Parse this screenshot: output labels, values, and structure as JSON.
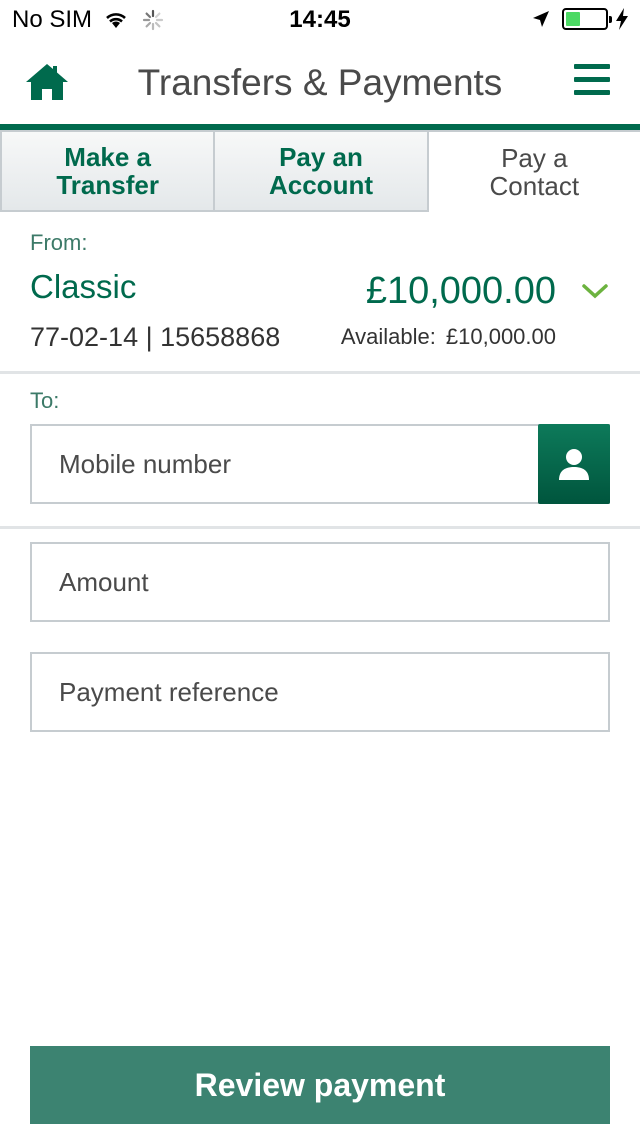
{
  "status_bar": {
    "carrier": "No SIM",
    "time": "14:45"
  },
  "header": {
    "title": "Transfers & Payments"
  },
  "tabs": [
    {
      "label": "Make a\nTransfer",
      "active": false
    },
    {
      "label": "Pay an\nAccount",
      "active": false
    },
    {
      "label": "Pay a\nContact",
      "active": true
    }
  ],
  "from": {
    "label": "From:",
    "account_name": "Classic",
    "balance": "£10,000.00",
    "sort_and_account": "77-02-14 | 15658868",
    "available_label": "Available:",
    "available_amount": "£10,000.00"
  },
  "to": {
    "label": "To:",
    "mobile_placeholder": "Mobile number"
  },
  "amount": {
    "placeholder": "Amount"
  },
  "reference": {
    "placeholder": "Payment reference"
  },
  "review_button": {
    "label": "Review payment"
  },
  "colors": {
    "brand_green": "#006a4d",
    "button_green": "#3c8371",
    "accent_chevron": "#6cb33f"
  }
}
